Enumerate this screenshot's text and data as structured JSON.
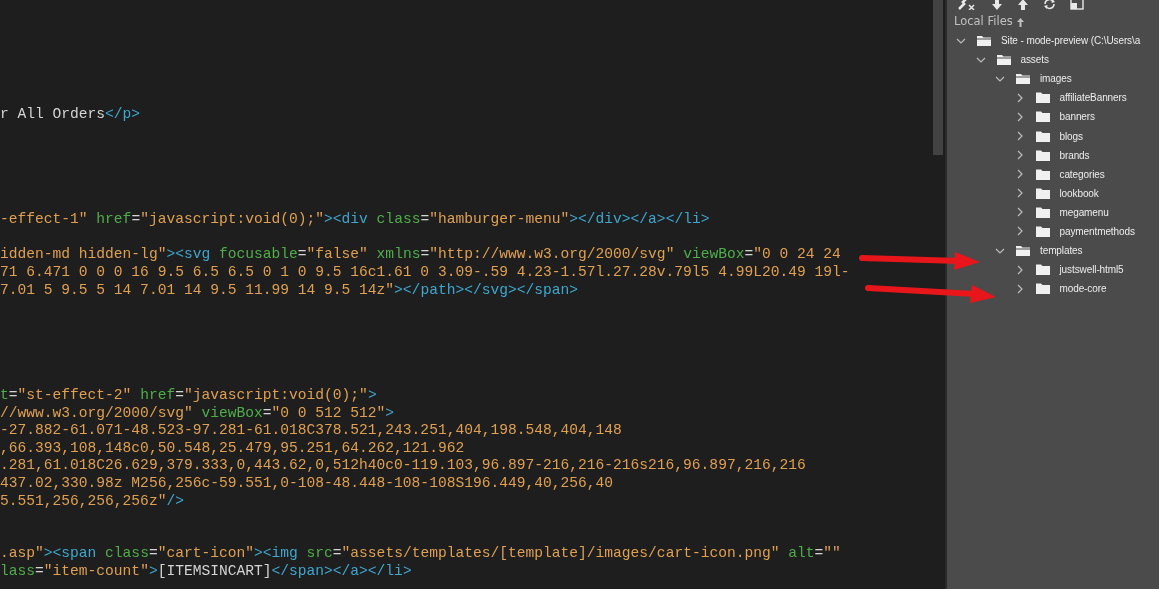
{
  "editor": {
    "lines": [
      {
        "kind": "blank"
      },
      {
        "kind": "blank"
      },
      {
        "kind": "blank"
      },
      {
        "kind": "blank"
      },
      {
        "kind": "blank"
      },
      {
        "kind": "blank"
      },
      {
        "kind": "code",
        "tokens": [
          {
            "kind": "text",
            "text": "r All Orders"
          },
          {
            "kind": "tag",
            "text": "</p>"
          }
        ]
      },
      {
        "kind": "blank"
      },
      {
        "kind": "blank"
      },
      {
        "kind": "blank"
      },
      {
        "kind": "blank"
      },
      {
        "kind": "blank"
      },
      {
        "kind": "code",
        "tokens": [
          {
            "kind": "string",
            "text": "-effect-1\""
          },
          {
            "kind": "attr",
            "text": " href"
          },
          {
            "kind": "text",
            "text": "="
          },
          {
            "kind": "string",
            "text": "\"javascript:void(0);\""
          },
          {
            "kind": "tag",
            "text": "><div"
          },
          {
            "kind": "attr",
            "text": " class"
          },
          {
            "kind": "text",
            "text": "="
          },
          {
            "kind": "string",
            "text": "\"hamburger-menu\""
          },
          {
            "kind": "tag",
            "text": "></div></a></li>"
          }
        ]
      },
      {
        "kind": "blank"
      },
      {
        "kind": "code",
        "tokens": [
          {
            "kind": "string",
            "text": "idden-md hidden-lg\""
          },
          {
            "kind": "tag",
            "text": "><svg"
          },
          {
            "kind": "attr",
            "text": " focusable"
          },
          {
            "kind": "text",
            "text": "="
          },
          {
            "kind": "string",
            "text": "\"false\""
          },
          {
            "kind": "attr",
            "text": " xmlns"
          },
          {
            "kind": "text",
            "text": "="
          },
          {
            "kind": "string",
            "text": "\"http://www.w3.org/2000/svg\""
          },
          {
            "kind": "attr",
            "text": " viewBox"
          },
          {
            "kind": "text",
            "text": "="
          },
          {
            "kind": "string",
            "text": "\"0 0 24 24"
          }
        ]
      },
      {
        "kind": "code",
        "tokens": [
          {
            "kind": "string",
            "text": "71 6.471 0 0 0 16 9.5 6.5 6.5 0 1 0 9.5 16c1.61 0 3.09-.59 4.23-1.57l.27.28v.79l5 4.99L20.49 19l-"
          }
        ]
      },
      {
        "kind": "code",
        "tokens": [
          {
            "kind": "string",
            "text": "7.01 5 9.5 5 14 7.01 14 9.5 11.99 14 9.5 14z\""
          },
          {
            "kind": "tag",
            "text": "></path></svg></span>"
          }
        ]
      },
      {
        "kind": "blank"
      },
      {
        "kind": "blank"
      },
      {
        "kind": "blank"
      },
      {
        "kind": "blank"
      },
      {
        "kind": "blank"
      },
      {
        "kind": "code",
        "tokens": [
          {
            "kind": "attr",
            "text": "t"
          },
          {
            "kind": "text",
            "text": "="
          },
          {
            "kind": "string",
            "text": "\"st-effect-2\""
          },
          {
            "kind": "attr",
            "text": " href"
          },
          {
            "kind": "text",
            "text": "="
          },
          {
            "kind": "string",
            "text": "\"javascript:void(0);\""
          },
          {
            "kind": "tag",
            "text": ">"
          }
        ]
      },
      {
        "kind": "code",
        "tokens": [
          {
            "kind": "string",
            "text": "//www.w3.org/2000/svg\""
          },
          {
            "kind": "attr",
            "text": " viewBox"
          },
          {
            "kind": "text",
            "text": "="
          },
          {
            "kind": "string",
            "text": "\"0 0 512 512\""
          },
          {
            "kind": "tag",
            "text": ">"
          }
        ]
      },
      {
        "kind": "code",
        "tokens": [
          {
            "kind": "string",
            "text": "-27.882-61.071-48.523-97.281-61.018C378.521,243.251,404,198.548,404,148"
          }
        ]
      },
      {
        "kind": "code",
        "tokens": [
          {
            "kind": "string",
            "text": ",66.393,108,148c0,50.548,25.479,95.251,64.262,121.962"
          }
        ]
      },
      {
        "kind": "code",
        "tokens": [
          {
            "kind": "string",
            "text": ".281,61.018C26.629,379.333,0,443.62,0,512h40c0-119.103,96.897-216,216-216s216,96.897,216,216"
          }
        ]
      },
      {
        "kind": "code",
        "tokens": [
          {
            "kind": "string",
            "text": "437.02,330.98z M256,256c-59.551,0-108-48.448-108-108S196.449,40,256,40"
          }
        ]
      },
      {
        "kind": "code",
        "tokens": [
          {
            "kind": "string",
            "text": "5.551,256,256,256z\""
          },
          {
            "kind": "tag",
            "text": "/>"
          }
        ]
      },
      {
        "kind": "blank"
      },
      {
        "kind": "blank"
      },
      {
        "kind": "code",
        "tokens": [
          {
            "kind": "string",
            "text": ".asp\""
          },
          {
            "kind": "tag",
            "text": "><span"
          },
          {
            "kind": "attr",
            "text": " class"
          },
          {
            "kind": "text",
            "text": "="
          },
          {
            "kind": "string",
            "text": "\"cart-icon\""
          },
          {
            "kind": "tag",
            "text": "><img"
          },
          {
            "kind": "attr",
            "text": " src"
          },
          {
            "kind": "text",
            "text": "="
          },
          {
            "kind": "string",
            "text": "\"assets/templates/[template]/images/cart-icon.png\""
          },
          {
            "kind": "attr",
            "text": " alt"
          },
          {
            "kind": "text",
            "text": "="
          },
          {
            "kind": "string",
            "text": "\"\""
          }
        ]
      },
      {
        "kind": "code",
        "tokens": [
          {
            "kind": "attr",
            "text": "lass"
          },
          {
            "kind": "text",
            "text": "="
          },
          {
            "kind": "string",
            "text": "\"item-count\""
          },
          {
            "kind": "tag",
            "text": ">"
          },
          {
            "kind": "text",
            "text": "[ITEMSINCART]"
          },
          {
            "kind": "tag",
            "text": "</span></a></li>"
          }
        ]
      }
    ]
  },
  "files_panel": {
    "title": "Local Files",
    "tree": [
      {
        "label": "Site - mode-preview (C:\\Users\\a",
        "expanded": true,
        "children": [
          {
            "label": "assets",
            "expanded": true,
            "children": [
              {
                "label": "images",
                "expanded": true,
                "children": [
                  {
                    "label": "affiliateBanners",
                    "expanded": false
                  },
                  {
                    "label": "banners",
                    "expanded": false
                  },
                  {
                    "label": "blogs",
                    "expanded": false
                  },
                  {
                    "label": "brands",
                    "expanded": false
                  },
                  {
                    "label": "categories",
                    "expanded": false
                  },
                  {
                    "label": "lookbook",
                    "expanded": false
                  },
                  {
                    "label": "megamenu",
                    "expanded": false
                  },
                  {
                    "label": "paymentmethods",
                    "expanded": false
                  }
                ]
              },
              {
                "label": "templates",
                "expanded": true,
                "children": [
                  {
                    "label": "justswell-html5",
                    "expanded": false
                  },
                  {
                    "label": "mode-core",
                    "expanded": false
                  }
                ]
              }
            ]
          }
        ]
      }
    ]
  }
}
